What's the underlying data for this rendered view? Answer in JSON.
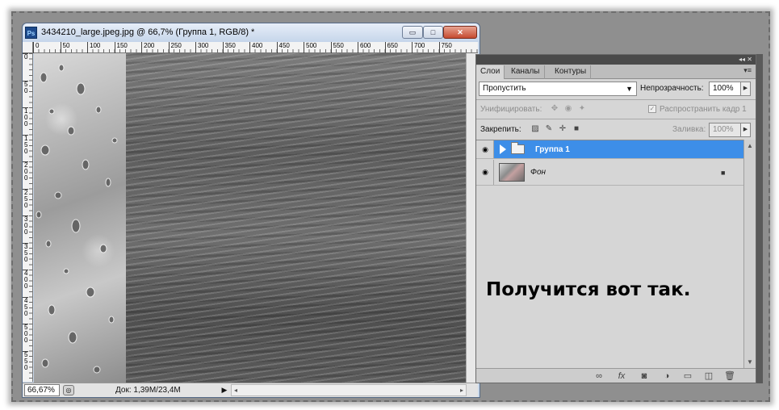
{
  "document": {
    "app_icon": "Ps",
    "title": "3434210_large.jpeg.jpg @ 66,7% (Группа 1, RGB/8) *",
    "window_buttons": {
      "minimize": "▭",
      "maximize": "□",
      "close": "✕"
    },
    "ruler_h_ticks": [
      "0",
      "50",
      "100",
      "150",
      "200",
      "250",
      "300",
      "350",
      "400",
      "450",
      "500",
      "550",
      "600",
      "650",
      "700",
      "750"
    ],
    "ruler_v_ticks": [
      "0",
      "50",
      "100",
      "150",
      "200",
      "250",
      "300",
      "350",
      "400",
      "450",
      "500",
      "550"
    ],
    "status": {
      "zoom": "66,67%",
      "doc_info": "Док: 1,39M/23,4M",
      "arrow": "▶",
      "scroll_left": "◂",
      "scroll_right": "▸"
    }
  },
  "layers_panel": {
    "dock_controls": "◂◂ ✕",
    "tabs": [
      {
        "label": "Слои",
        "active": true
      },
      {
        "label": "Каналы",
        "active": false
      },
      {
        "label": "Контуры",
        "active": false
      }
    ],
    "panel_menu_icon": "▾≡",
    "blend_mode": "Пропустить",
    "opacity_label": "Непрозрачность:",
    "opacity_value": "100%",
    "unify_label": "Унифицировать:",
    "propagate_label": "Распространить кадр 1",
    "propagate_checked": true,
    "lock_label": "Закрепить:",
    "fill_label": "Заливка:",
    "fill_value": "100%",
    "layers": [
      {
        "name": "Группа 1",
        "type": "group",
        "selected": true,
        "visible": true
      },
      {
        "name": "Фон",
        "type": "image",
        "selected": false,
        "visible": true,
        "locked": true
      }
    ],
    "caption": "Получится вот так.",
    "footer_icons": [
      "link-layers-icon",
      "fx-icon",
      "add-mask-icon",
      "adjustment-layer-icon",
      "new-group-icon",
      "new-layer-icon",
      "delete-layer-icon"
    ]
  },
  "colors": {
    "selection": "#3d8ee8",
    "panel_bg": "#d6d6d6",
    "title_gradient_top": "#e7eef8",
    "close_button": "#c54a2f"
  }
}
